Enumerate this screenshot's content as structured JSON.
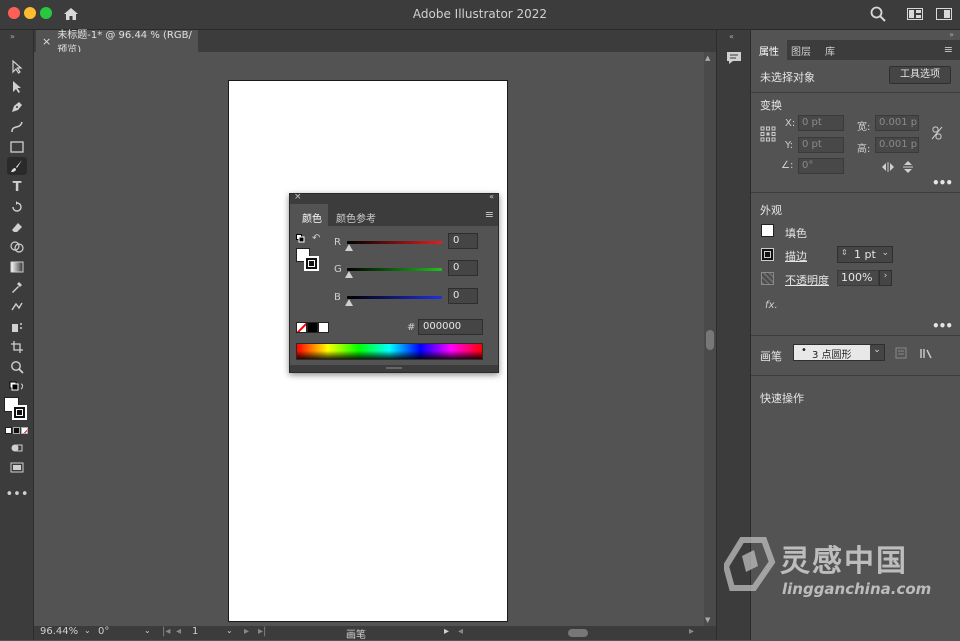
{
  "app": {
    "title": "Adobe Illustrator 2022",
    "colors": {
      "close": "#ff5f57",
      "minimize": "#febc2e",
      "maximize": "#28c840"
    }
  },
  "document": {
    "tab_label": "未标题-1* @ 96.44 % (RGB/预览)",
    "tab_close": "×"
  },
  "status": {
    "zoom": "96.44%",
    "rotation": "0°",
    "artboard_number": "1",
    "tool_name": "画笔"
  },
  "color_panel": {
    "tabs": [
      "颜色",
      "颜色参考"
    ],
    "channels": [
      {
        "label": "R",
        "value": "0",
        "color": "#e02020"
      },
      {
        "label": "G",
        "value": "0",
        "color": "#20c020"
      },
      {
        "label": "B",
        "value": "0",
        "color": "#2030e0"
      }
    ],
    "hex_label": "#",
    "hex_value": "000000"
  },
  "properties": {
    "tabs": [
      "属性",
      "图层",
      "库"
    ],
    "selection_label": "未选择对象",
    "tool_options_button": "工具选项",
    "transform": {
      "title": "变换",
      "x_label": "X:",
      "x_value": "0 pt",
      "y_label": "Y:",
      "y_value": "0 pt",
      "w_label": "宽:",
      "w_value": "0.001 p",
      "h_label": "高:",
      "h_value": "0.001 p",
      "angle_value": "0°"
    },
    "appearance": {
      "title": "外观",
      "fill_label": "填色",
      "stroke_label": "描边",
      "stroke_value": "1 pt",
      "opacity_label": "不透明度",
      "opacity_value": "100%",
      "fx_label": "fx."
    },
    "brush": {
      "label": "画笔",
      "value": "3 点圆形"
    },
    "quick_actions_title": "快速操作"
  },
  "watermark": {
    "name": "灵感中国",
    "url": "lingganchina.com"
  }
}
